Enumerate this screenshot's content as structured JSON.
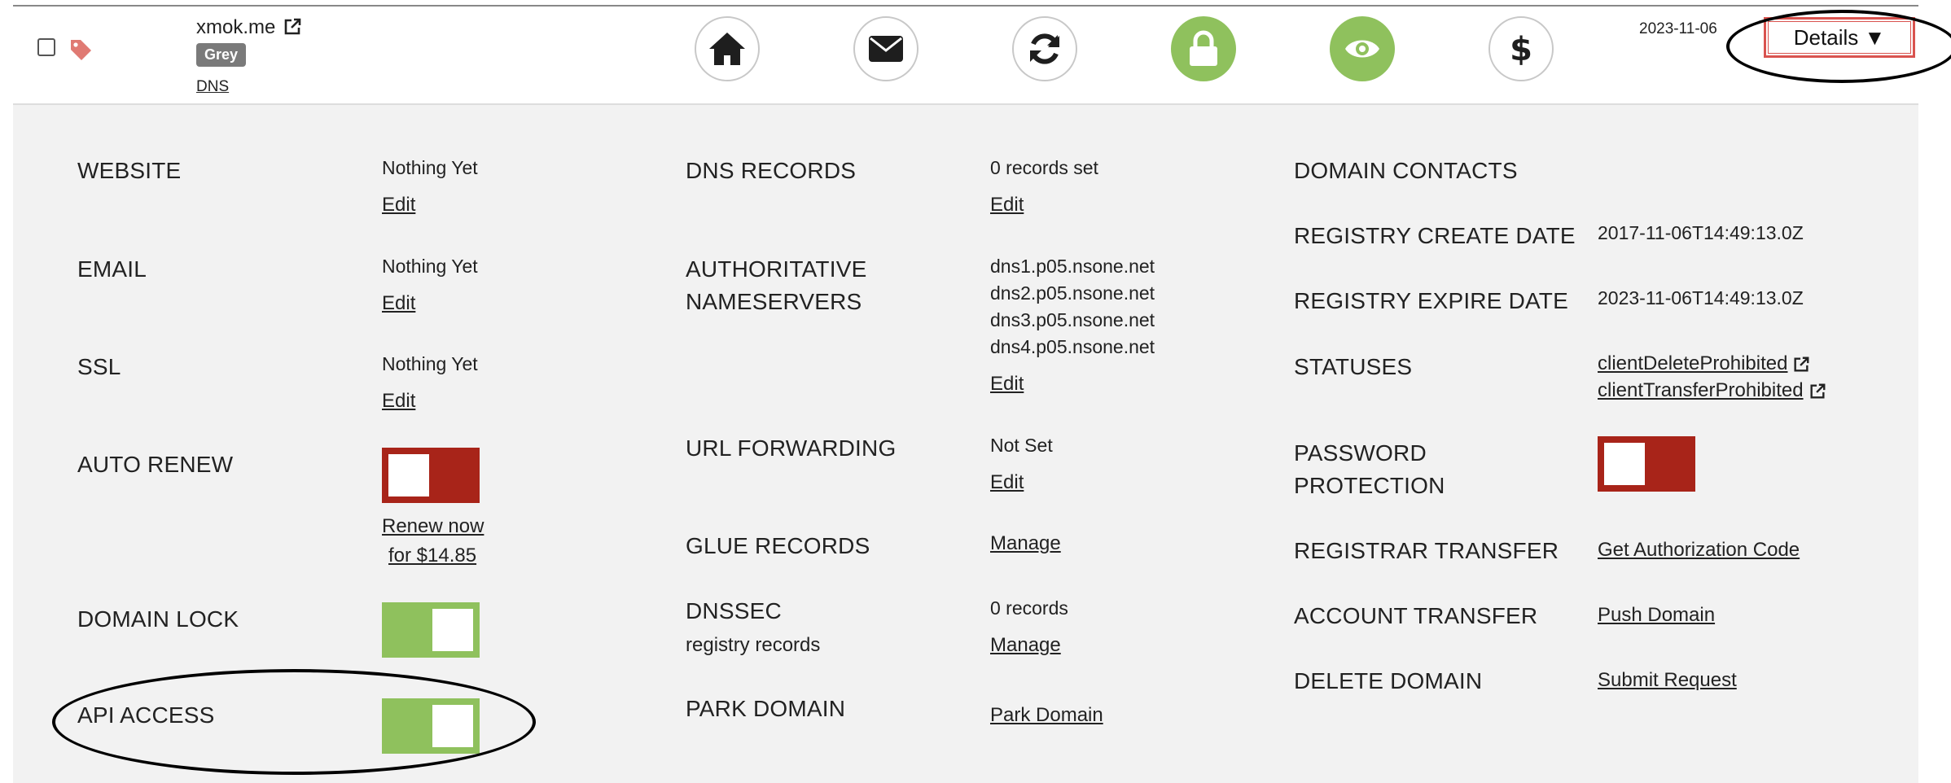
{
  "header": {
    "domain": "xmok.me",
    "badge": "Grey",
    "dns_link": "DNS",
    "date": "2023-11-06",
    "details_label": "Details ▼",
    "action_icons": [
      "home-icon",
      "envelope-icon",
      "sync-icon",
      "lock-icon",
      "eye-icon",
      "dollar-icon"
    ]
  },
  "col1": {
    "website": {
      "label": "WEBSITE",
      "value": "Nothing Yet",
      "edit": "Edit"
    },
    "email": {
      "label": "EMAIL",
      "value": "Nothing Yet",
      "edit": "Edit"
    },
    "ssl": {
      "label": "SSL",
      "value": "Nothing Yet",
      "edit": "Edit"
    },
    "auto_renew": {
      "label": "AUTO RENEW",
      "toggle": "off",
      "renew_line1": "Renew now",
      "renew_line2": "for $14.85"
    },
    "domain_lock": {
      "label": "DOMAIN LOCK",
      "toggle": "on"
    },
    "api_access": {
      "label": "API ACCESS",
      "toggle": "on"
    }
  },
  "col2": {
    "dns_records": {
      "label": "DNS RECORDS",
      "value": "0 records set",
      "edit": "Edit"
    },
    "nameservers": {
      "label_line1": "AUTHORITATIVE",
      "label_line2": "NAMESERVERS",
      "ns1": "dns1.p05.nsone.net",
      "ns2": "dns2.p05.nsone.net",
      "ns3": "dns3.p05.nsone.net",
      "ns4": "dns4.p05.nsone.net",
      "edit": "Edit"
    },
    "url_forwarding": {
      "label": "URL FORWARDING",
      "value": "Not Set",
      "edit": "Edit"
    },
    "glue_records": {
      "label": "GLUE RECORDS",
      "link": "Manage"
    },
    "dnssec": {
      "label": "DNSSEC",
      "sub": "registry records",
      "value": "0 records",
      "link": "Manage"
    },
    "park_domain": {
      "label": "PARK DOMAIN",
      "link": "Park Domain"
    }
  },
  "col3": {
    "domain_contacts": {
      "label": "DOMAIN CONTACTS"
    },
    "create_date": {
      "label": "REGISTRY CREATE DATE",
      "value": "2017-11-06T14:49:13.0Z"
    },
    "expire_date": {
      "label": "REGISTRY EXPIRE DATE",
      "value": "2023-11-06T14:49:13.0Z"
    },
    "statuses": {
      "label": "STATUSES",
      "status1": "clientDeleteProhibited",
      "status2": "clientTransferProhibited"
    },
    "password_protection": {
      "label_line1": "PASSWORD",
      "label_line2": "PROTECTION",
      "toggle": "off"
    },
    "registrar_transfer": {
      "label": "REGISTRAR TRANSFER",
      "link": "Get Authorization Code"
    },
    "account_transfer": {
      "label": "ACCOUNT TRANSFER",
      "link": "Push Domain"
    },
    "delete_domain": {
      "label": "DELETE DOMAIN",
      "link": "Submit Request"
    }
  },
  "colors": {
    "toggle_on": "#8fc15d",
    "toggle_off": "#a82419",
    "panel_bg": "#f2f2f2",
    "details_border": "#d9534f"
  }
}
